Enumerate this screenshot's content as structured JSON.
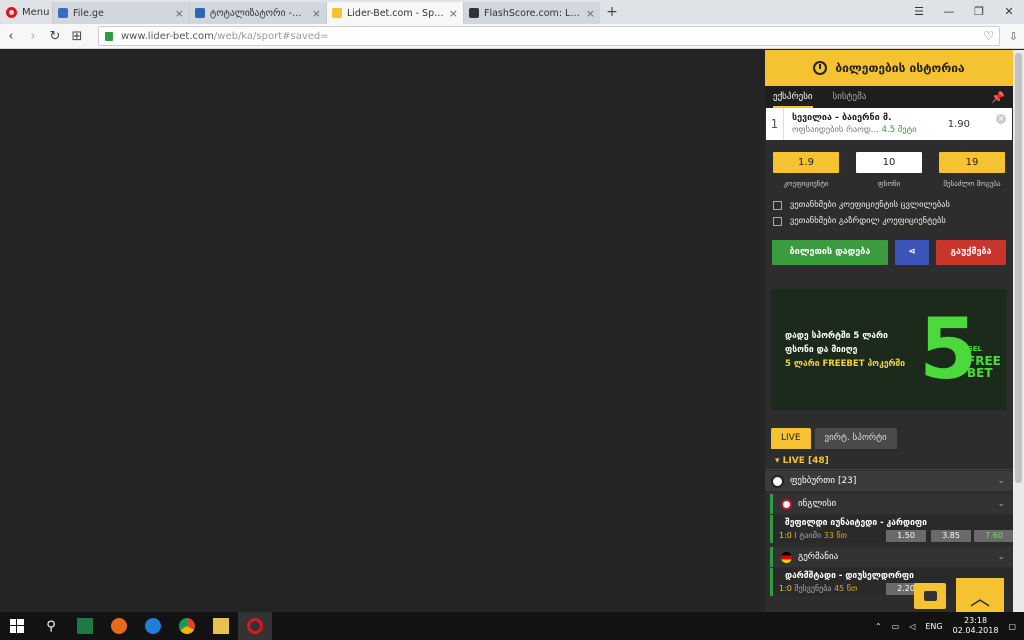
{
  "browser": {
    "menu_label": "Menu",
    "tabs": [
      {
        "title": "File.ge",
        "color": "#3b6bbf"
      },
      {
        "title": "ტოტალიზატორი -> თბ",
        "color": "#2d66b3"
      },
      {
        "title": "Lider-Bet.com - Sports and",
        "color": "#f5c232"
      },
      {
        "title": "FlashScore.com: Live Foot",
        "color": "#333333"
      }
    ],
    "url_domain": "www.lider-bet.com",
    "url_path": "/web/ka/sport#saved="
  },
  "betslip": {
    "history_title": "ბილეთების ისტორია",
    "tab_express": "ექსპრესი",
    "tab_system": "სისტემა",
    "item": {
      "index": "1",
      "match": "სევილია - ბაიერნი მ.",
      "market": "ოფსაიდების რაოდ...",
      "line": "4.5 მეტი",
      "odd": "1.90"
    },
    "coef_value": "1.9",
    "coef_label": "კოეფიციენტი",
    "stake_value": "10",
    "stake_label": "ფსონი",
    "win_value": "19",
    "win_label": "შესაძლო მოგება",
    "agree_change": "ვეთანხმები კოეფიციენტის ცვლილებას",
    "agree_higher": "ვეთანხმები გაზრდილ კოეფიციენტებს",
    "place_btn": "ბილეთის დადება",
    "cancel_btn": "გაუქმება"
  },
  "banner": {
    "line1": "დადე სპორტში 5 ლარი",
    "line2": "ფსონი და მიიღე",
    "line3": "5 ლარი FREEBET პოკერში",
    "big": "5",
    "side1": "GEL",
    "side2": "FREE",
    "side3": "BET"
  },
  "live": {
    "tab_live": "LIVE",
    "tab_virtual": "ვირტ. სპორტი",
    "header": "LIVE [48]",
    "sport": "ფეხბურთი [23]",
    "country1": "ინგლისი",
    "event1": {
      "name": "შეფილდი იუნაიტედი - კარდიფი",
      "score": "1:0",
      "period": "I ტაიმი",
      "minute": "33 წთ",
      "odds": [
        "1.50",
        "3.85",
        "7.60"
      ]
    },
    "country2": "გერმანია",
    "event2": {
      "name": "დარმშტადი - დიუსელდორფი",
      "score": "1:0",
      "period": "შესვენება",
      "minute": "45 წთ",
      "odds": [
        "2.20"
      ]
    }
  },
  "taskbar": {
    "lang": "ENG",
    "time": "23:18",
    "date": "02.04.2018"
  }
}
